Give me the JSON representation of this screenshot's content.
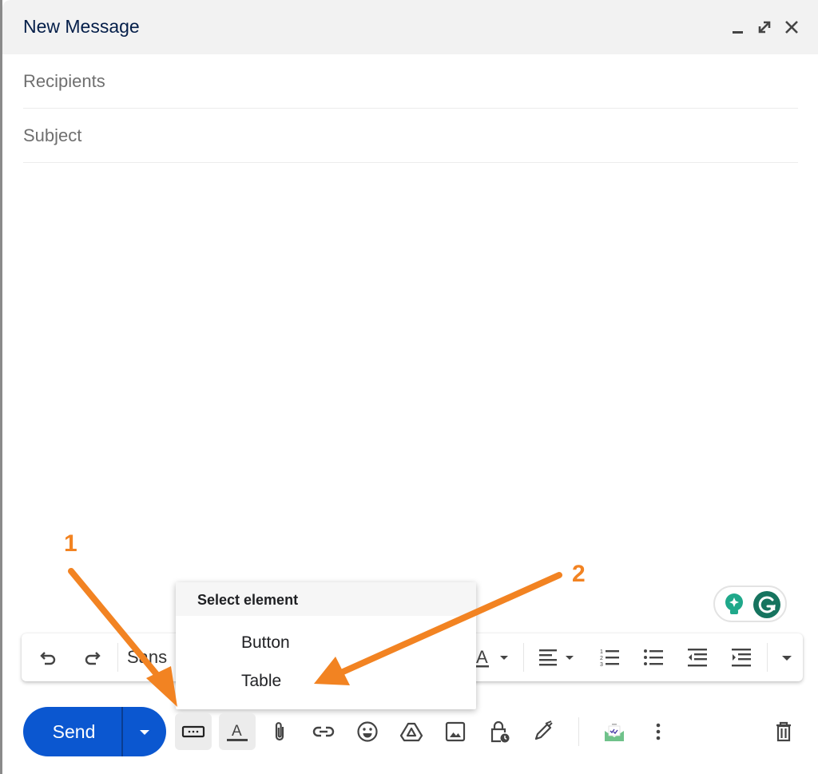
{
  "window": {
    "title": "New Message",
    "controls": [
      {
        "name": "minimize-icon",
        "label": "Minimize"
      },
      {
        "name": "expand-icon",
        "label": "Full screen"
      },
      {
        "name": "close-icon",
        "label": "Close"
      }
    ]
  },
  "compose": {
    "recipients_placeholder": "Recipients",
    "recipients_value": "",
    "subject_placeholder": "Subject",
    "subject_value": "",
    "body_value": ""
  },
  "grammarly": {
    "icons": [
      "lightbulb-icon",
      "grammarly-g-icon"
    ]
  },
  "format_toolbar": {
    "font_label": "Sans",
    "buttons": [
      "undo-icon",
      "redo-icon",
      "font-family-select",
      "text-color-icon",
      "align-icon",
      "numbered-list-icon",
      "bulleted-list-icon",
      "indent-less-icon",
      "indent-more-icon",
      "more-formatting-icon"
    ]
  },
  "menu": {
    "header": "Select element",
    "items": [
      {
        "label": "Button"
      },
      {
        "label": "Table"
      }
    ]
  },
  "bottom_bar": {
    "send_label": "Send",
    "buttons": [
      "layout-element-icon",
      "formatting-options-icon",
      "attach-icon",
      "link-icon",
      "emoji-icon",
      "drive-icon",
      "photo-icon",
      "confidential-mode-icon",
      "signature-icon",
      "email-tracker-icon",
      "more-options-icon",
      "discard-icon"
    ]
  },
  "annotations": {
    "step1": "1",
    "step2": "2",
    "color": "#f28322"
  },
  "colors": {
    "send_blue": "#0b57d0",
    "title_text": "#041e49",
    "titlebar_bg": "#f2f2f2",
    "grammarly_green": "#16745f"
  }
}
